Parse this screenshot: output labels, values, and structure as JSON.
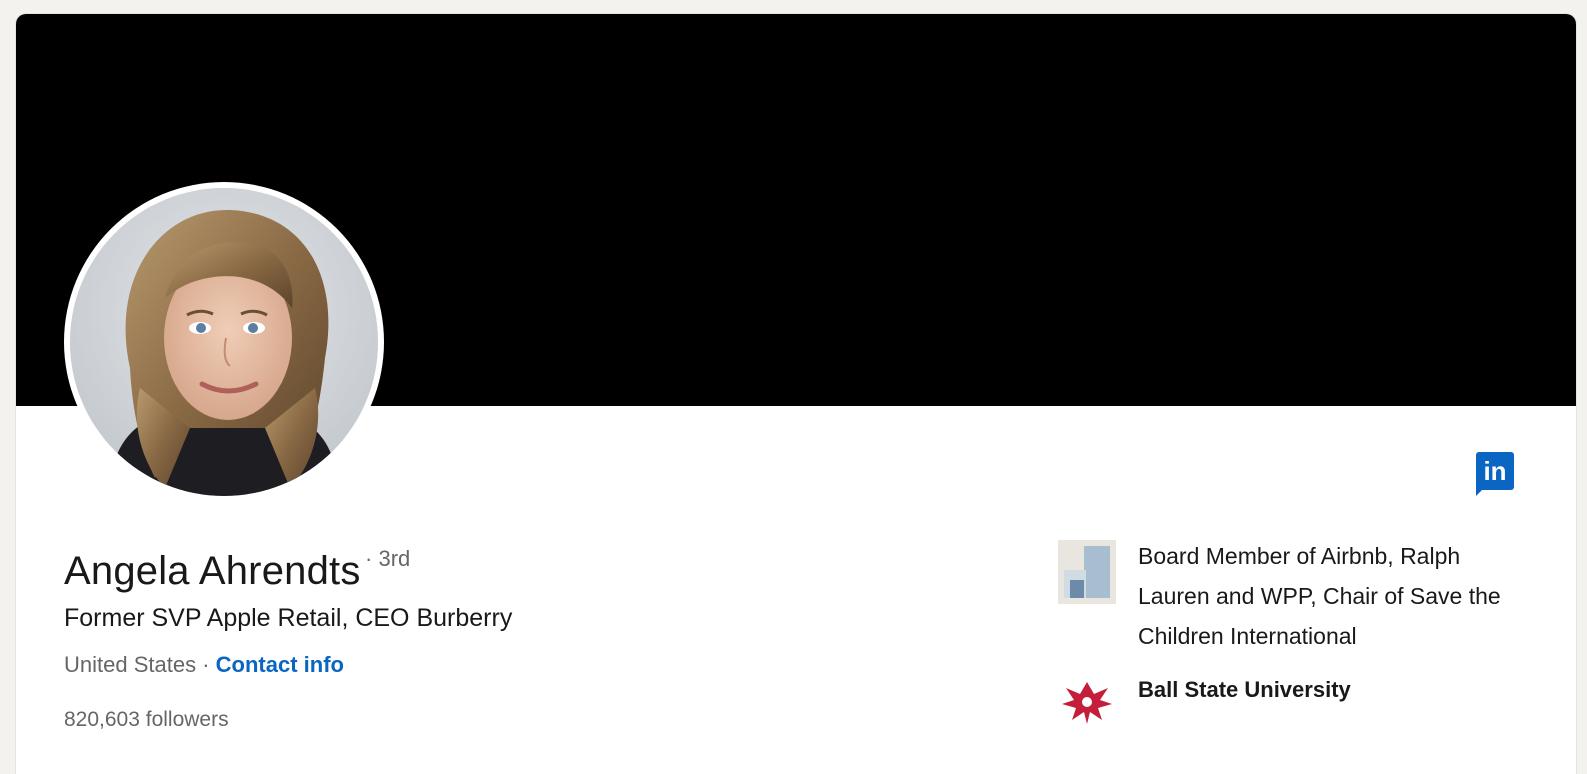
{
  "profile": {
    "name": "Angela Ahrendts",
    "degree": "· 3rd",
    "headline": "Former SVP Apple Retail, CEO Burberry",
    "location": "United States ·",
    "contact_label": "Contact info",
    "followers": "820,603 followers"
  },
  "badge": {
    "label": "in",
    "icon": "linkedin-icon"
  },
  "organizations": [
    {
      "name": "Board Member of Airbnb, Ralph Lauren and WPP, Chair of Save the Children International",
      "icon": "company-placeholder-icon"
    },
    {
      "name": "Ball State University",
      "icon": "ball-state-logo-icon"
    }
  ],
  "colors": {
    "accent": "#0a66c2",
    "cover": "#000000",
    "text_primary": "#191919",
    "text_secondary": "#666666",
    "page_bg": "#f3f2ef"
  }
}
